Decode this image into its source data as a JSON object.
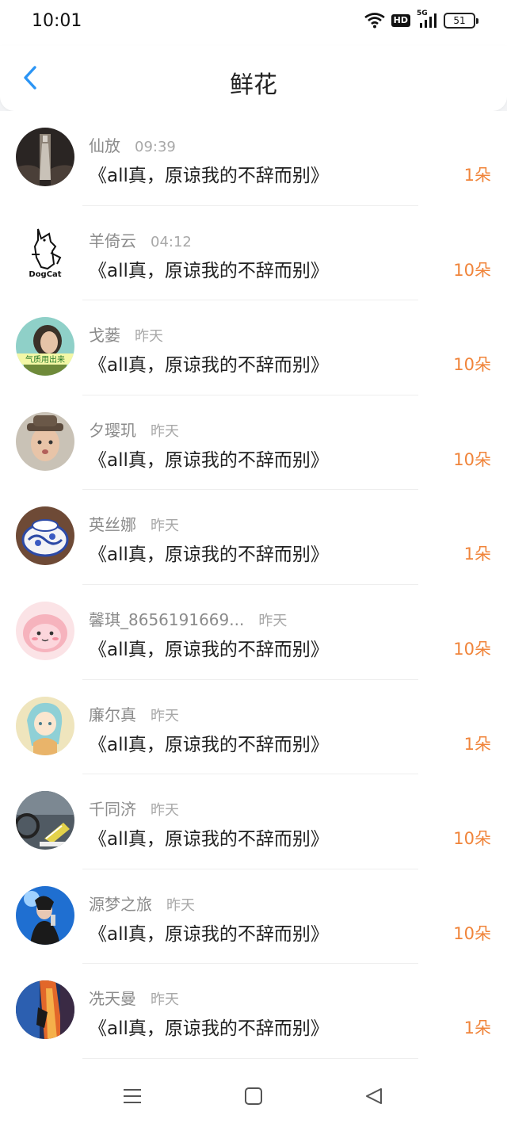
{
  "status_bar": {
    "time": "10:01",
    "hd_label": "HD",
    "network_label": "5G",
    "battery": "51",
    "icons": [
      "wifi-icon",
      "hd-icon",
      "signal-icon",
      "battery-icon"
    ]
  },
  "header": {
    "title": "鲜花",
    "back_icon": "chevron-left-icon",
    "accent_color": "#2b95f5"
  },
  "gifts": [
    {
      "name": "仙放",
      "time": "09:39",
      "message": "《all真，原谅我的不辞而别》",
      "count": "1朵"
    },
    {
      "name": "羊倚云",
      "time": "04:12",
      "message": "《all真，原谅我的不辞而别》",
      "count": "10朵"
    },
    {
      "name": "戈蒌",
      "time": "昨天",
      "message": "《all真，原谅我的不辞而别》",
      "count": "10朵"
    },
    {
      "name": "夕璎玑",
      "time": "昨天",
      "message": "《all真，原谅我的不辞而别》",
      "count": "10朵"
    },
    {
      "name": "英丝娜",
      "time": "昨天",
      "message": "《all真，原谅我的不辞而别》",
      "count": "1朵"
    },
    {
      "name": "馨琪_8656191669...",
      "time": "昨天",
      "message": "《all真，原谅我的不辞而别》",
      "count": "10朵"
    },
    {
      "name": "廉尔真",
      "time": "昨天",
      "message": "《all真，原谅我的不辞而别》",
      "count": "1朵"
    },
    {
      "name": "千同济",
      "time": "昨天",
      "message": "《all真，原谅我的不辞而别》",
      "count": "10朵"
    },
    {
      "name": "源梦之旅",
      "time": "昨天",
      "message": "《all真，原谅我的不辞而别》",
      "count": "10朵"
    },
    {
      "name": "冼天曼",
      "time": "昨天",
      "message": "《all真，原谅我的不辞而别》",
      "count": "1朵"
    }
  ],
  "avatar_texts": {
    "dogcat": "DogCat",
    "qizhi": "气质用出来"
  },
  "count_color": "#f0843a",
  "system_nav": {
    "icons": [
      "menu-icon",
      "home-icon",
      "back-icon"
    ]
  }
}
